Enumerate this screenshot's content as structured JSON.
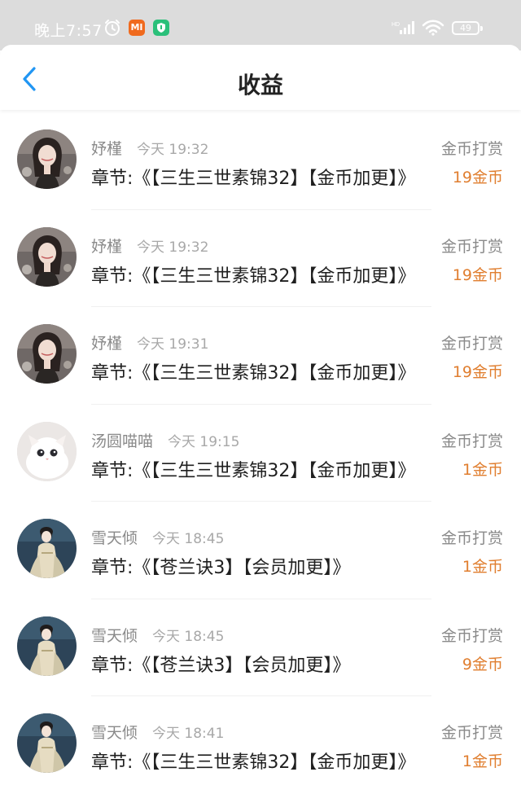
{
  "status_bar": {
    "time": "晚上7:57",
    "mi_label": "MI",
    "battery": "49",
    "network": "HD"
  },
  "header": {
    "title": "收益",
    "back_icon": "chevron-left-icon"
  },
  "colors": {
    "accent": "#2196f3",
    "amount": "#e07e2f",
    "muted": "#8a8a8a"
  },
  "records": [
    {
      "name": "妤槿",
      "time": "今天 19:32",
      "type": "金币打赏",
      "chapter": "章节:《【三生三世素锦32】【金币加更】》",
      "amount": "19金币",
      "avatar": "girl"
    },
    {
      "name": "妤槿",
      "time": "今天 19:32",
      "type": "金币打赏",
      "chapter": "章节:《【三生三世素锦32】【金币加更】》",
      "amount": "19金币",
      "avatar": "girl"
    },
    {
      "name": "妤槿",
      "time": "今天 19:31",
      "type": "金币打赏",
      "chapter": "章节:《【三生三世素锦32】【金币加更】》",
      "amount": "19金币",
      "avatar": "girl"
    },
    {
      "name": "汤圆喵喵",
      "time": "今天 19:15",
      "type": "金币打赏",
      "chapter": "章节:《【三生三世素锦32】【金币加更】》",
      "amount": "1金币",
      "avatar": "cat"
    },
    {
      "name": "雪天倾",
      "time": "今天 18:45",
      "type": "金币打赏",
      "chapter": "章节:《【苍兰诀3】【会员加更】》",
      "amount": "1金币",
      "avatar": "hanfu"
    },
    {
      "name": "雪天倾",
      "time": "今天 18:45",
      "type": "金币打赏",
      "chapter": "章节:《【苍兰诀3】【会员加更】》",
      "amount": "9金币",
      "avatar": "hanfu"
    },
    {
      "name": "雪天倾",
      "time": "今天 18:41",
      "type": "金币打赏",
      "chapter": "章节:《【三生三世素锦32】【金币加更】》",
      "amount": "1金币",
      "avatar": "hanfu"
    }
  ]
}
